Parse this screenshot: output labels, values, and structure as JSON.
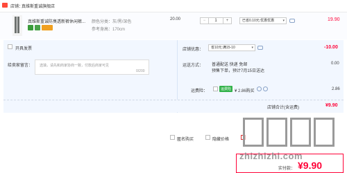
{
  "shop": {
    "label": "店铺：",
    "name": "真维斯重诚旗舰店"
  },
  "product": {
    "title": "真维斯重诚防臭透新裤休闲裤...",
    "color_label": "颜色分类：灰/黑/深色",
    "size_label": "参考身高：170cm",
    "unit_price": "20.00",
    "quantity": "1",
    "minus": "−",
    "plus": "+",
    "discount_select": "已省0.10元:优惠优惠",
    "subtotal": "19.90"
  },
  "left_options": {
    "invoice_label": "开具发票"
  },
  "message": {
    "label": "给卖家留言：",
    "placeholder": "选填，请先和商家协商一致，付款后商家可见",
    "counter": "0/200"
  },
  "shop_coupon": {
    "label": "店铺优惠：",
    "select": "省10元:满15-10",
    "amount": "-10.00"
  },
  "shipping": {
    "label": "运送方式：",
    "method": "普通配送 快递 免邮",
    "note": "预售下单，预计7月15日送达",
    "amount": "0.00"
  },
  "freight_insurance": {
    "label": "运费险：",
    "badge": "运费险",
    "price": "¥ 2.86购买",
    "amount": "2.86"
  },
  "shop_total": {
    "label": "店铺合计(含运费)",
    "amount": "¥9.90"
  },
  "bottom_options": {
    "anonymous": "匿名购买",
    "gift": "隐藏价格"
  },
  "footer": {
    "paid_label": "实付款：",
    "paid_amount": "¥9.90"
  },
  "watermark": {
    "text": "zhizhizhi.com"
  },
  "colors": {
    "accent": "#ff0036",
    "panel_bg": "#f2f7ff",
    "header_bg": "#f5f5f5"
  }
}
